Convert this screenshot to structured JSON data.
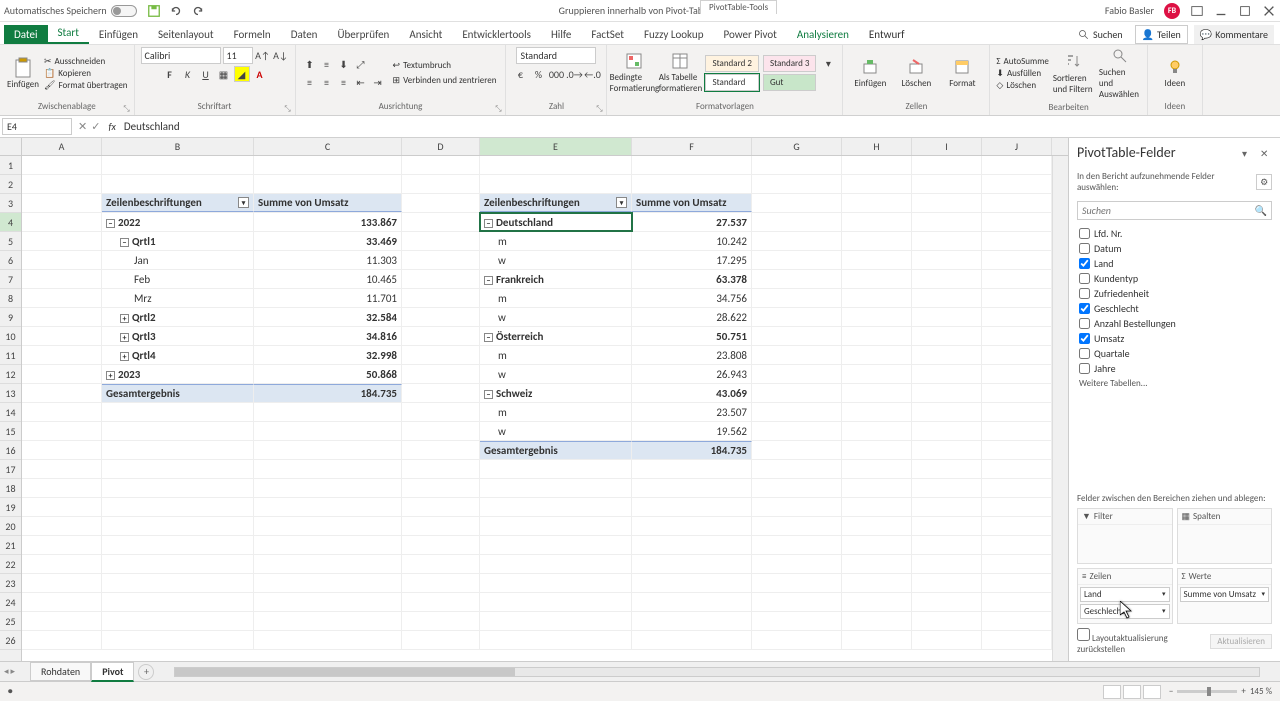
{
  "titlebar": {
    "autosave": "Automatisches Speichern",
    "doc_title": "Gruppieren innerhalb von Pivot-Tabellen - Excel",
    "tool_tab": "PivotTable-Tools",
    "user": "Fabio Basler",
    "initials": "FB"
  },
  "tabs": {
    "file": "Datei",
    "items": [
      "Start",
      "Einfügen",
      "Seitenlayout",
      "Formeln",
      "Daten",
      "Überprüfen",
      "Ansicht",
      "Entwicklertools",
      "Hilfe",
      "FactSet",
      "Fuzzy Lookup",
      "Power Pivot",
      "Analysieren",
      "Entwurf"
    ],
    "active": "Start",
    "search_hint": "Suchen",
    "share": "Teilen",
    "comments": "Kommentare"
  },
  "ribbon": {
    "clipboard": {
      "label": "Zwischenablage",
      "cut": "Ausschneiden",
      "copy": "Kopieren",
      "paint": "Format übertragen",
      "paste": "Einfügen"
    },
    "font": {
      "label": "Schriftart",
      "name": "Calibri",
      "size": "11"
    },
    "align": {
      "label": "Ausrichtung",
      "wrap": "Textumbruch",
      "merge": "Verbinden und zentrieren"
    },
    "number": {
      "label": "Zahl",
      "format": "Standard"
    },
    "styles": {
      "label": "Formatvorlagen",
      "cond": "Bedingte Formatierung",
      "table": "Als Tabelle formatieren",
      "s1": "Standard 2",
      "s2": "Standard 3",
      "s3": "Standard",
      "s4": "Gut"
    },
    "cells": {
      "label": "Zellen",
      "insert": "Einfügen",
      "delete": "Löschen",
      "format": "Format"
    },
    "editing": {
      "label": "Bearbeiten",
      "sum": "AutoSumme",
      "fill": "Ausfüllen",
      "clear": "Löschen",
      "sort": "Sortieren und Filtern",
      "find": "Suchen und Auswählen"
    },
    "ideas": {
      "label": "Ideen",
      "btn": "Ideen"
    }
  },
  "formula": {
    "cell": "E4",
    "value": "Deutschland"
  },
  "columns": [
    "A",
    "B",
    "C",
    "D",
    "E",
    "F",
    "G",
    "H",
    "I",
    "J"
  ],
  "pivot_left": {
    "hdr1": "Zeilenbeschriftungen",
    "hdr2": "Summe von Umsatz",
    "rows": [
      {
        "label": "2022",
        "val": "133.867",
        "exp": "-",
        "bold": true
      },
      {
        "label": "Qrtl1",
        "val": "33.469",
        "exp": "-",
        "bold": true,
        "indent": 1
      },
      {
        "label": "Jan",
        "val": "11.303",
        "indent": 2
      },
      {
        "label": "Feb",
        "val": "10.465",
        "indent": 2
      },
      {
        "label": "Mrz",
        "val": "11.701",
        "indent": 2
      },
      {
        "label": "Qrtl2",
        "val": "32.584",
        "exp": "+",
        "bold": true,
        "indent": 1
      },
      {
        "label": "Qrtl3",
        "val": "34.816",
        "exp": "+",
        "bold": true,
        "indent": 1
      },
      {
        "label": "Qrtl4",
        "val": "32.998",
        "exp": "+",
        "bold": true,
        "indent": 1
      },
      {
        "label": "2023",
        "val": "50.868",
        "exp": "+",
        "bold": true
      },
      {
        "label": "Gesamtergebnis",
        "val": "184.735",
        "bold": true,
        "total": true
      }
    ]
  },
  "pivot_right": {
    "hdr1": "Zeilenbeschriftungen",
    "hdr2": "Summe von Umsatz",
    "rows": [
      {
        "label": "Deutschland",
        "val": "27.537",
        "exp": "-",
        "bold": true,
        "sel": true
      },
      {
        "label": "m",
        "val": "10.242",
        "indent": 1
      },
      {
        "label": "w",
        "val": "17.295",
        "indent": 1
      },
      {
        "label": "Frankreich",
        "val": "63.378",
        "exp": "-",
        "bold": true
      },
      {
        "label": "m",
        "val": "34.756",
        "indent": 1
      },
      {
        "label": "w",
        "val": "28.622",
        "indent": 1
      },
      {
        "label": "Österreich",
        "val": "50.751",
        "exp": "-",
        "bold": true
      },
      {
        "label": "m",
        "val": "23.808",
        "indent": 1
      },
      {
        "label": "w",
        "val": "26.943",
        "indent": 1
      },
      {
        "label": "Schweiz",
        "val": "43.069",
        "exp": "-",
        "bold": true
      },
      {
        "label": "m",
        "val": "23.507",
        "indent": 1
      },
      {
        "label": "w",
        "val": "19.562",
        "indent": 1
      },
      {
        "label": "Gesamtergebnis",
        "val": "184.735",
        "bold": true,
        "total": true
      }
    ]
  },
  "taskpane": {
    "title": "PivotTable-Felder",
    "subtitle": "In den Bericht aufzunehmende Felder auswählen:",
    "search": "Suchen",
    "fields": [
      {
        "name": "Lfd. Nr.",
        "chk": false
      },
      {
        "name": "Datum",
        "chk": false
      },
      {
        "name": "Land",
        "chk": true
      },
      {
        "name": "Kundentyp",
        "chk": false
      },
      {
        "name": "Zufriedenheit",
        "chk": false
      },
      {
        "name": "Geschlecht",
        "chk": true
      },
      {
        "name": "Anzahl Bestellungen",
        "chk": false
      },
      {
        "name": "Umsatz",
        "chk": true
      },
      {
        "name": "Quartale",
        "chk": false
      },
      {
        "name": "Jahre",
        "chk": false
      }
    ],
    "more": "Weitere Tabellen...",
    "drag_hint": "Felder zwischen den Bereichen ziehen und ablegen:",
    "areas": {
      "filter": "Filter",
      "cols": "Spalten",
      "rows": "Zeilen",
      "vals": "Werte"
    },
    "row_items": [
      "Land",
      "Geschlecht"
    ],
    "val_items": [
      "Summe von Umsatz"
    ],
    "defer": "Layoutaktualisierung zurückstellen",
    "update": "Aktualisieren"
  },
  "sheets": {
    "tab1": "Rohdaten",
    "tab2": "Pivot"
  },
  "status": {
    "zoom": "145 %"
  }
}
